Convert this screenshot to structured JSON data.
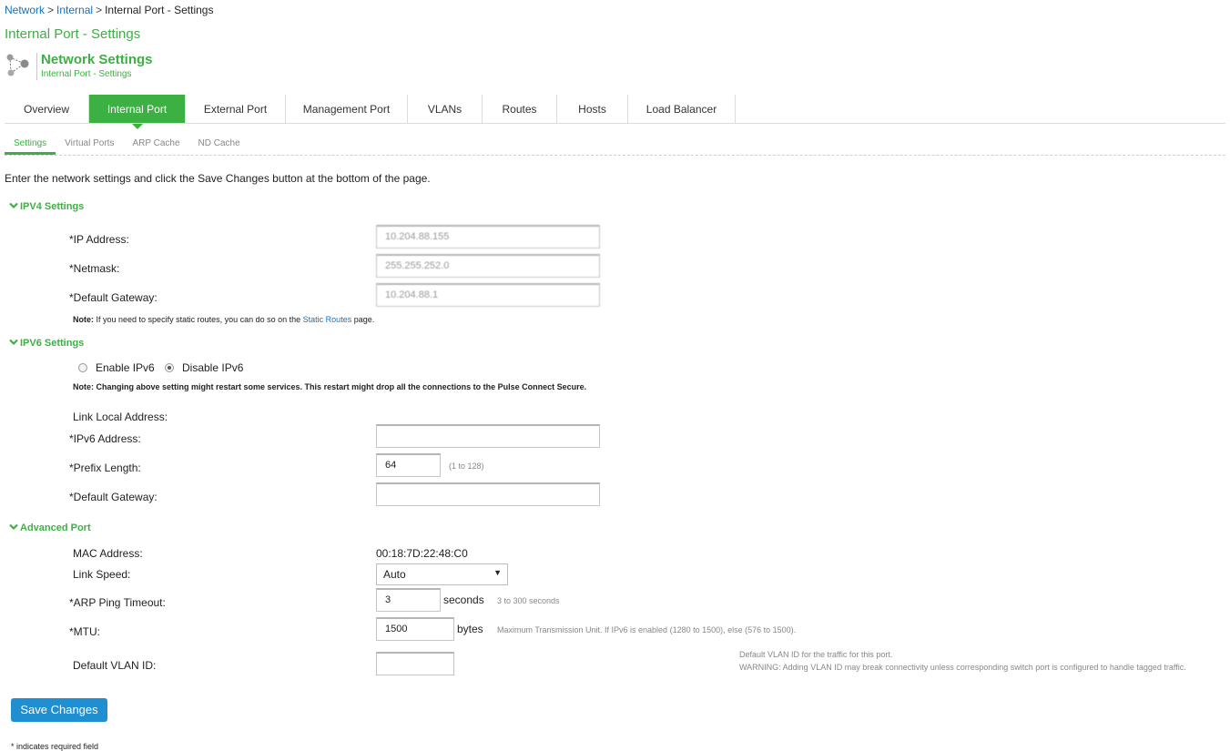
{
  "breadcrumb": {
    "items": [
      "Network",
      "Internal"
    ],
    "current": "Internal Port - Settings",
    "separator": ">"
  },
  "page_title": "Internal Port - Settings",
  "header": {
    "title": "Network Settings",
    "subtitle": "Internal Port - Settings",
    "icon": "network-nodes-icon"
  },
  "tabs": [
    {
      "label": "Overview",
      "active": false
    },
    {
      "label": "Internal Port",
      "active": true
    },
    {
      "label": "External Port",
      "active": false
    },
    {
      "label": "Management Port",
      "active": false
    },
    {
      "label": "VLANs",
      "active": false
    },
    {
      "label": "Routes",
      "active": false
    },
    {
      "label": "Hosts",
      "active": false
    },
    {
      "label": "Load Balancer",
      "active": false
    }
  ],
  "subtabs": [
    {
      "label": "Settings",
      "active": true
    },
    {
      "label": "Virtual Ports",
      "active": false
    },
    {
      "label": "ARP Cache",
      "active": false
    },
    {
      "label": "ND Cache",
      "active": false
    }
  ],
  "intro": "Enter the network settings and click the Save Changes button at the bottom of the page.",
  "ipv4": {
    "heading": "IPV4 Settings",
    "ip_label": "*IP Address:",
    "ip_value": "10.204.88.155",
    "netmask_label": "*Netmask:",
    "netmask_value": "255.255.252.0",
    "gateway_label": "*Default Gateway:",
    "gateway_value": "10.204.88.1",
    "note_prefix": "Note:",
    "note_text": "If you need to specify static routes, you can do so on the",
    "note_link": "Static Routes",
    "note_suffix": "page."
  },
  "ipv6": {
    "heading": "IPV6 Settings",
    "enable_label": "Enable IPv6",
    "disable_label": "Disable IPv6",
    "selected": "Disable IPv6",
    "note": "Note: Changing above setting might restart some services. This restart might drop all the connections to the Pulse Connect Secure.",
    "link_local_label": "Link Local Address:",
    "address_label": "*IPv6 Address:",
    "address_value": "",
    "prefix_label": "*Prefix Length:",
    "prefix_value": "64",
    "prefix_hint": "(1 to 128)",
    "gateway_label": "*Default Gateway:",
    "gateway_value": ""
  },
  "advanced": {
    "heading": "Advanced Port",
    "mac_label": "MAC Address:",
    "mac_value": "00:18:7D:22:48:C0",
    "speed_label": "Link Speed:",
    "speed_value": "Auto",
    "arp_label": "*ARP Ping Timeout:",
    "arp_value": "3",
    "arp_unit": "seconds",
    "arp_hint": "3 to 300 seconds",
    "mtu_label": "*MTU:",
    "mtu_value": "1500",
    "mtu_unit": "bytes",
    "mtu_hint": "Maximum Transmission Unit. If IPv6 is enabled (1280 to 1500), else (576 to 1500).",
    "vlan_label": "Default VLAN ID:",
    "vlan_value": "",
    "vlan_hint_1": "Default VLAN ID for the traffic for this port.",
    "vlan_hint_2": "WARNING: Adding VLAN ID may break connectivity unless corresponding switch port is configured to handle tagged traffic."
  },
  "save_label": "Save Changes",
  "required_note": "* indicates required field",
  "colors": {
    "accent": "#3cb043",
    "link": "#1a6fb5",
    "button": "#1f8fd1"
  }
}
